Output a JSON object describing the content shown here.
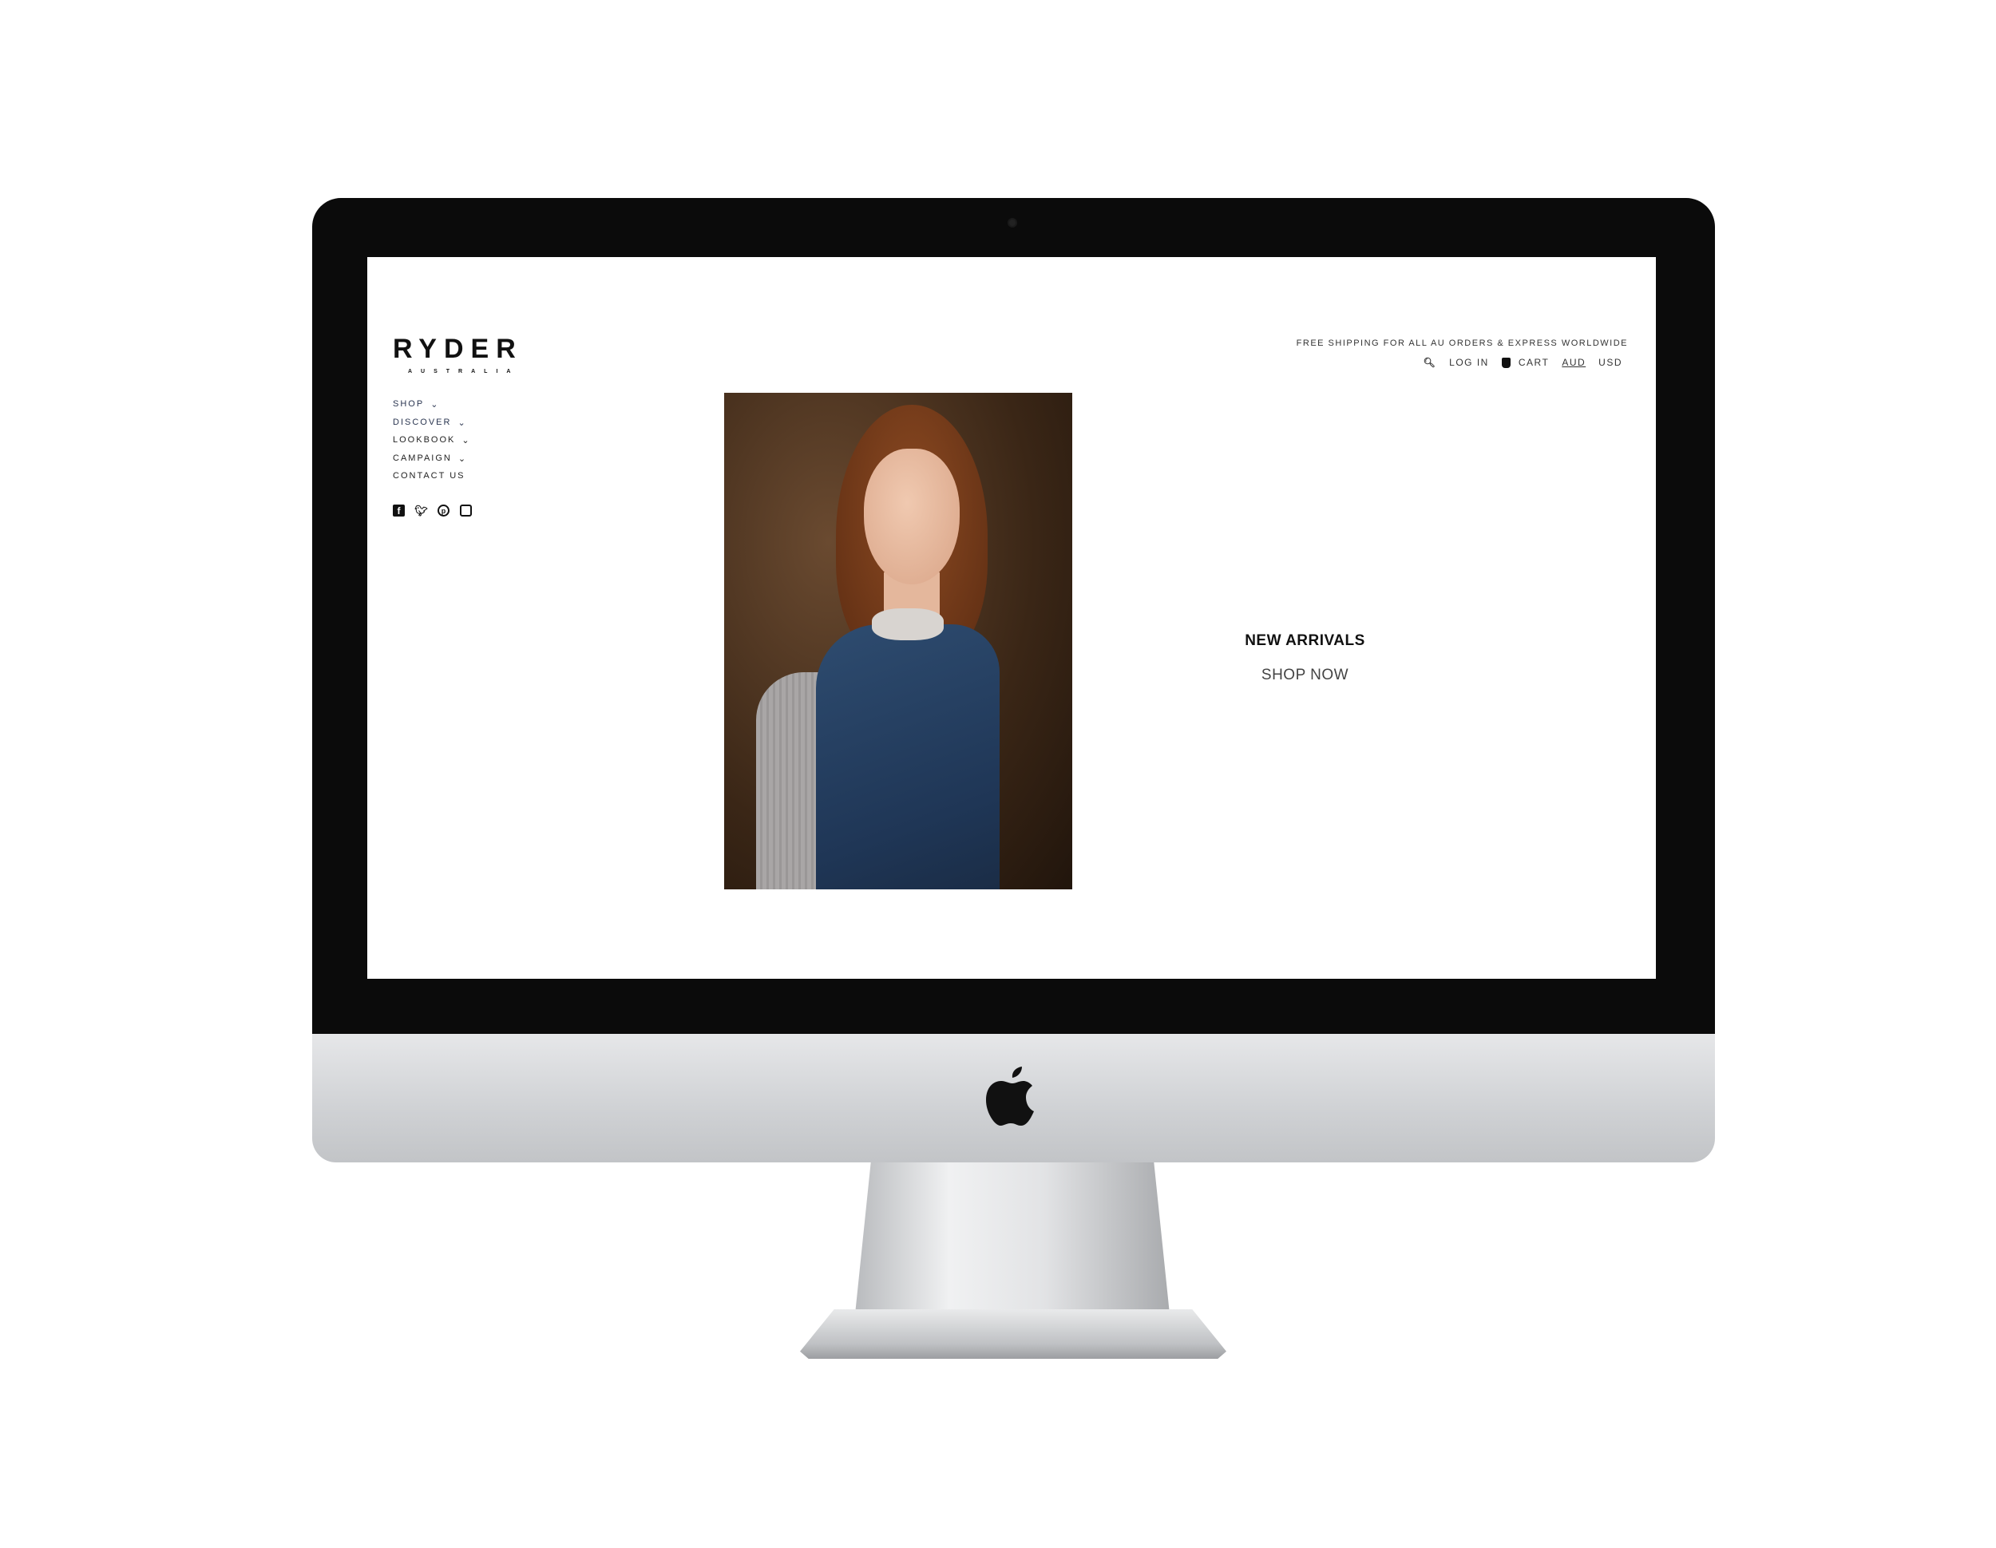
{
  "site": {
    "logo": "RYDER",
    "logo_sub": "AUSTRALIA"
  },
  "nav": [
    {
      "label": "SHOP",
      "chevron": "⌄"
    },
    {
      "label": "DISCOVER",
      "chevron": "⌄"
    },
    {
      "label": "LOOKBOOK",
      "chevron": "⌄"
    },
    {
      "label": "CAMPAIGN",
      "chevron": "⌄"
    },
    {
      "label": "CONTACT US"
    }
  ],
  "social": [
    "facebook-icon",
    "twitter-icon",
    "pinterest-icon",
    "instagram-icon"
  ],
  "header": {
    "shipping": "FREE SHIPPING FOR ALL AU ORDERS & EXPRESS WORLDWIDE",
    "login": "LOG IN",
    "cart": "CART",
    "currency_selected": "AUD",
    "currency_other": "USD"
  },
  "hero": {
    "title": "NEW ARRIVALS",
    "cta": "SHOP NOW"
  }
}
